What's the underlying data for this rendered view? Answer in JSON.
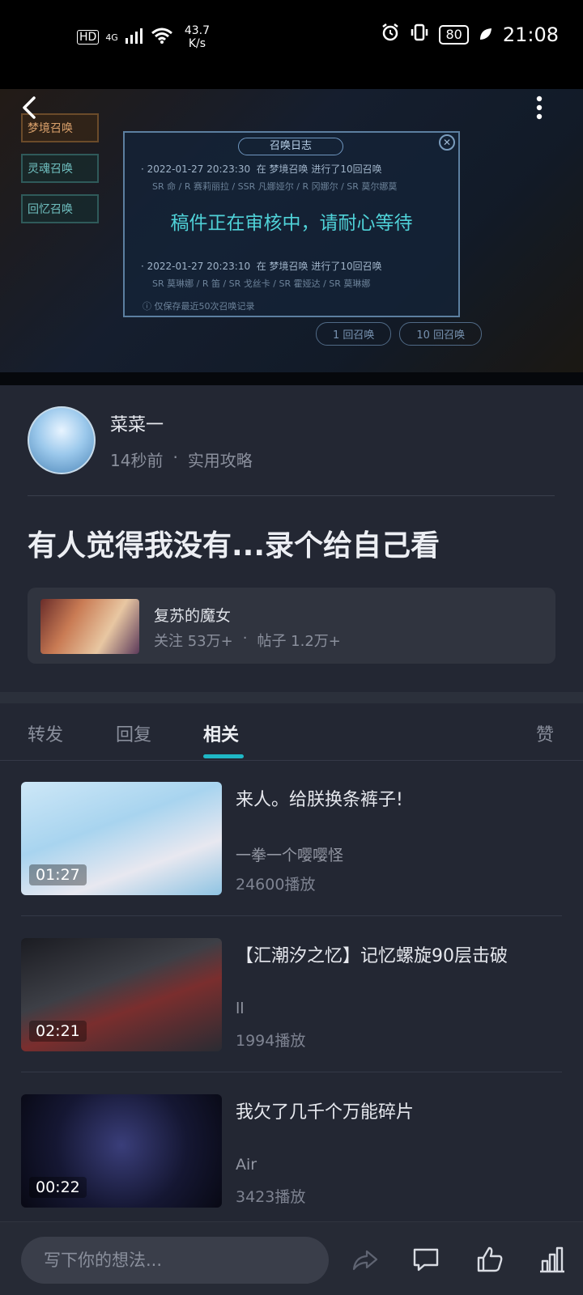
{
  "status_bar": {
    "hd": "HD",
    "signal": "4G",
    "net_speed": "43.7",
    "net_unit": "K/s",
    "battery": "80",
    "time": "21:08"
  },
  "video": {
    "review_text": "稿件正在审核中，请耐心等待",
    "game_overlay": {
      "menu": [
        "梦境召唤",
        "灵魂召唤",
        "回忆召唤"
      ],
      "dialog_title": "召唤日志",
      "logs": [
        {
          "time": "2022-01-27 20:23:30",
          "text": "在 梦境召唤 进行了10回召唤",
          "detail": "SR 命 / R 赛莉丽拉 / SSR 凡娜娅尔 / R 冈娜尔 / SR 莫尔娜莫"
        },
        {
          "time": "2022-01-27 20:23:10",
          "text": "在 梦境召唤 进行了10回召唤",
          "detail": "SR 莫琳娜 / R 笛 / SR 戈丝卡 / SR 霍娅达 / SR 莫琳娜"
        }
      ],
      "footer": "仅保存最近50次召唤记录",
      "btn1": "1 回召唤",
      "btn10": "10 回召唤"
    }
  },
  "author": {
    "name": "菜菜一",
    "time_ago": "14秒前",
    "dot": "·",
    "category": "实用攻略"
  },
  "post": {
    "title": "有人觉得我没有...录个给自己看"
  },
  "game_card": {
    "name": "复苏的魔女",
    "follow": "关注 53万+",
    "dot": "·",
    "posts": "帖子 1.2万+"
  },
  "tabs": [
    {
      "label": "转发"
    },
    {
      "label": "回复"
    },
    {
      "label": "相关"
    },
    {
      "label": "赞"
    }
  ],
  "related": [
    {
      "title": "来人。给朕换条裤子!",
      "author": "一拳一个嘤嘤怪",
      "plays": "24600播放",
      "duration": "01:27"
    },
    {
      "title": "【汇潮汐之忆】记忆螺旋90层击破",
      "author": "ll",
      "plays": "1994播放",
      "duration": "02:21"
    },
    {
      "title": "我欠了几千个万能碎片",
      "author": "Air",
      "plays": "3423播放",
      "duration": "00:22"
    }
  ],
  "bottom_bar": {
    "placeholder": "写下你的想法..."
  }
}
